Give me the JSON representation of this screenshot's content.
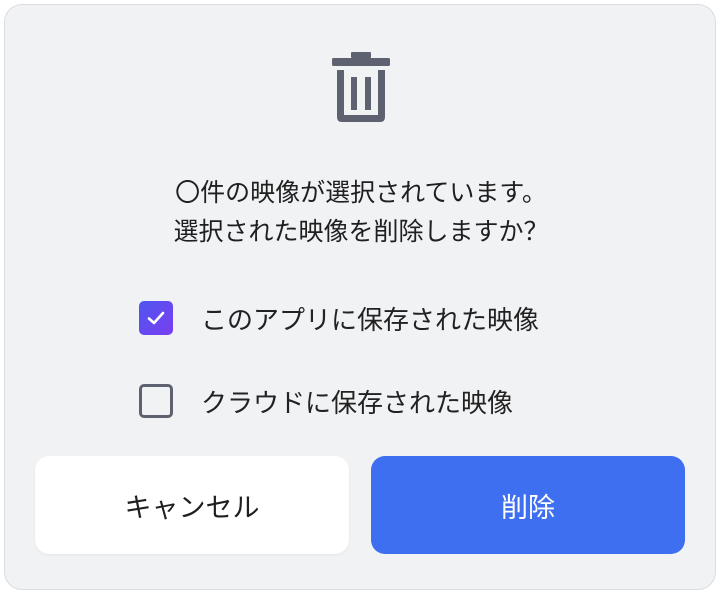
{
  "dialog": {
    "icon": "trash-icon",
    "message_line1": "〇件の映像が選択されています。",
    "message_line2": "選択された映像を削除しますか？",
    "options": [
      {
        "label": "このアプリに保存された映像",
        "checked": true
      },
      {
        "label": "クラウドに保存された映像",
        "checked": false
      }
    ],
    "cancel_label": "キャンセル",
    "delete_label": "削除"
  },
  "colors": {
    "dialog_bg": "#f1f2f4",
    "delete_button": "#3d6ff0",
    "checkbox_checked_start": "#4f56f0",
    "checkbox_checked_end": "#7a3ef0",
    "icon": "#5e6270"
  }
}
